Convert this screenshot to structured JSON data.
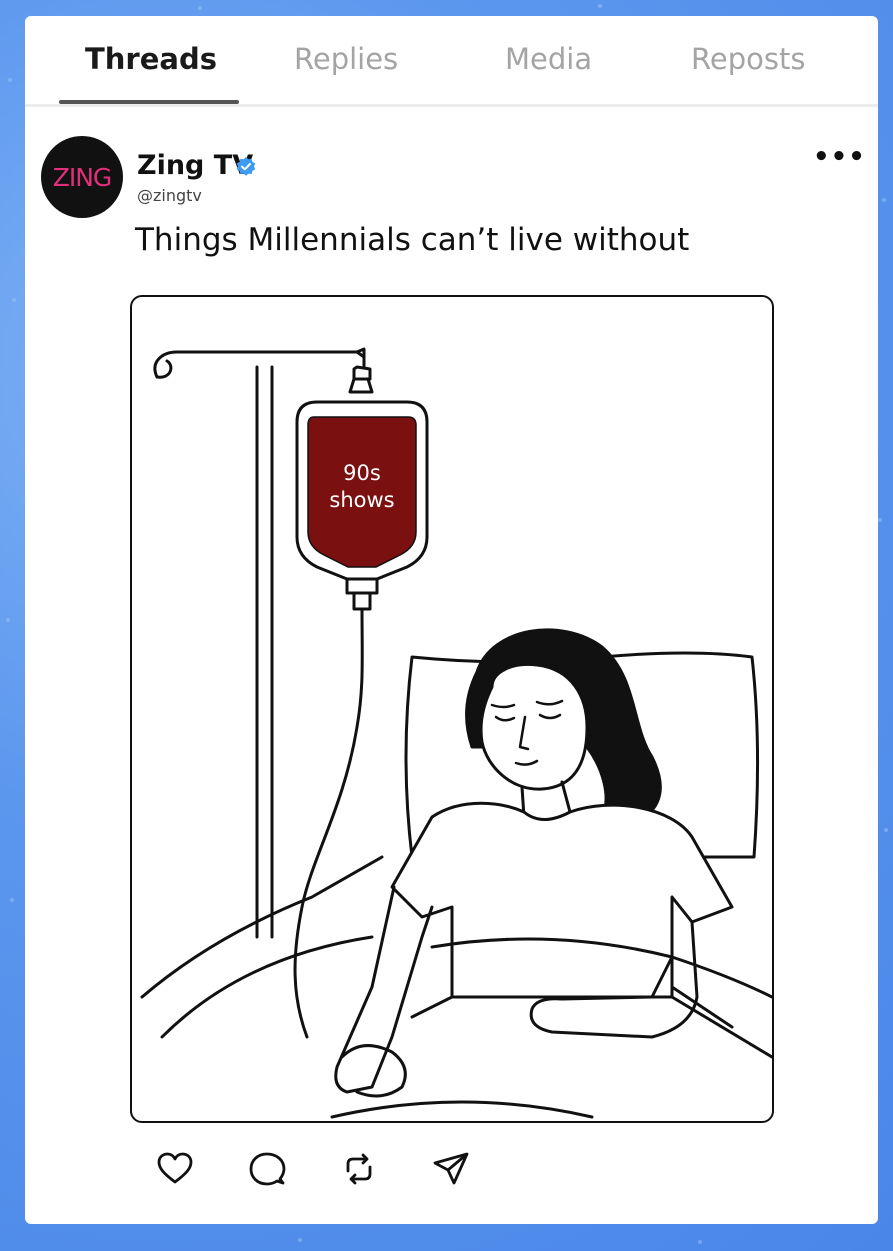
{
  "tabs": [
    {
      "label": "Threads",
      "active": true
    },
    {
      "label": "Replies",
      "active": false
    },
    {
      "label": "Media",
      "active": false
    },
    {
      "label": "Reposts",
      "active": false
    }
  ],
  "post": {
    "avatar_text": "ZING",
    "author_name": "Zing TV",
    "verified": true,
    "handle": "@zingtv",
    "more_label": "•••",
    "caption": "Things Millennials can’t live without",
    "image": {
      "bag_label_line1": "90s",
      "bag_label_line2": "shows"
    },
    "actions": [
      {
        "name": "like-icon"
      },
      {
        "name": "comment-icon"
      },
      {
        "name": "repost-icon"
      },
      {
        "name": "share-icon"
      }
    ]
  },
  "colors": {
    "background": "#5c97ee",
    "card": "#ffffff",
    "avatar_bg": "#111111",
    "avatar_text": "#e0307a",
    "verified": "#3d9bf2",
    "bag_fill": "#7a1010",
    "tab_inactive": "#a4a4a4"
  }
}
